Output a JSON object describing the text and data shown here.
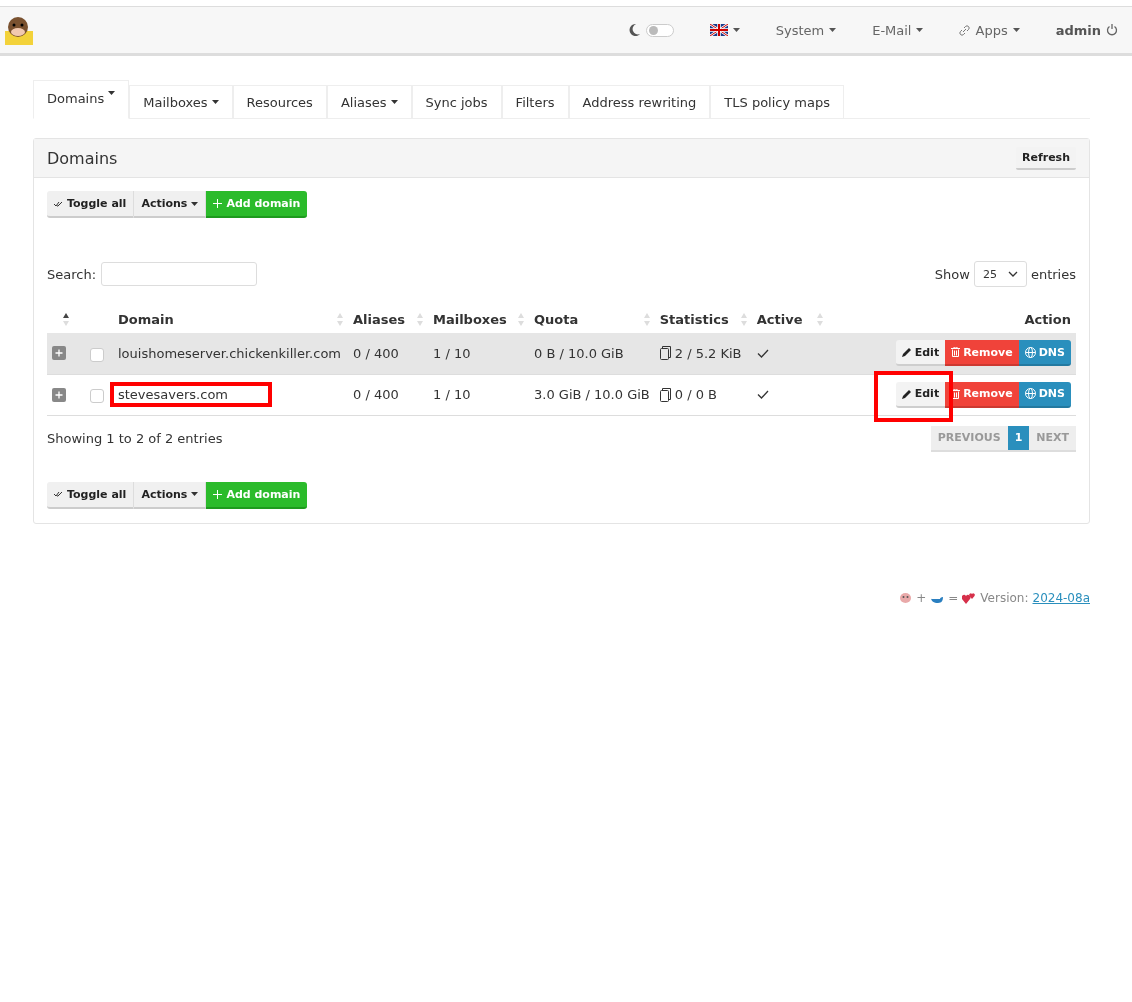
{
  "navbar": {
    "dark_mode": {
      "on": false
    },
    "menus": [
      {
        "label": "System"
      },
      {
        "label": "E-Mail"
      },
      {
        "label": "Apps"
      }
    ],
    "user": "admin"
  },
  "tabs": [
    {
      "label": "Domains",
      "dropdown": true,
      "selected": true
    },
    {
      "label": "Mailboxes",
      "dropdown": true,
      "selected": false
    },
    {
      "label": "Resources",
      "dropdown": false,
      "selected": false
    },
    {
      "label": "Aliases",
      "dropdown": true,
      "selected": false
    },
    {
      "label": "Sync jobs",
      "dropdown": false,
      "selected": false
    },
    {
      "label": "Filters",
      "dropdown": false,
      "selected": false
    },
    {
      "label": "Address rewriting",
      "dropdown": false,
      "selected": false
    },
    {
      "label": "TLS policy maps",
      "dropdown": false,
      "selected": false
    }
  ],
  "panel": {
    "title": "Domains",
    "refresh": "Refresh",
    "toolbar_top": {
      "toggle": "Toggle all",
      "actions": "Actions",
      "add": "Add domain"
    },
    "search": {
      "label": "Search:"
    },
    "length": {
      "show": "Show",
      "value": "25",
      "entries": "entries"
    },
    "table": {
      "columns": [
        {
          "sortable": true,
          "sorted": true
        },
        {},
        {
          "label": "Domain",
          "sortable": true,
          "sorted": false
        },
        {
          "label": "Aliases",
          "sortable": true,
          "sorted": false
        },
        {
          "label": "Mailboxes",
          "sortable": true,
          "sorted": false
        },
        {
          "label": "Quota",
          "sortable": true,
          "sorted": false
        },
        {
          "label": "Statistics",
          "sortable": true,
          "sorted": false
        },
        {
          "label": "Active",
          "sortable": true,
          "sorted": false
        },
        {
          "label": "Action"
        }
      ],
      "rows": [
        {
          "checked": false,
          "domain": "louishomeserver.chickenkiller.com",
          "aliases": "0 / 400",
          "mailboxes": "1 / 10",
          "quota": "0 B / 10.0 GiB",
          "statistics": "2 / 5.2 KiB",
          "active": true,
          "domain_highlighted": false,
          "edit_highlighted": false,
          "edit": "Edit",
          "remove": "Remove",
          "dns": "DNS"
        },
        {
          "checked": false,
          "domain": "stevesavers.com",
          "aliases": "0 / 400",
          "mailboxes": "1 / 10",
          "quota": "3.0 GiB / 10.0 GiB",
          "statistics": "0 / 0 B",
          "active": true,
          "domain_highlighted": true,
          "edit_highlighted": true,
          "edit": "Edit",
          "remove": "Remove",
          "dns": "DNS"
        }
      ]
    },
    "info": "Showing 1 to 2 of 2 entries",
    "pagination": [
      {
        "label": "PREVIOUS",
        "disabled": true,
        "selected": false
      },
      {
        "label": "1",
        "disabled": false,
        "selected": true
      },
      {
        "label": "NEXT",
        "disabled": true,
        "selected": false
      }
    ],
    "toolbar_bottom": {
      "toggle": "Toggle all",
      "actions": "Actions",
      "add": "Add domain"
    }
  },
  "footer": {
    "plus": "+",
    "equals": "=",
    "version_label": "Version:",
    "version": "2024-08a"
  }
}
